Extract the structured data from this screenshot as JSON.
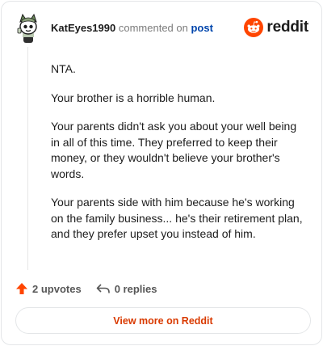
{
  "header": {
    "username": "KatEyes1990",
    "action_text": "commented on",
    "target_link": "post",
    "brand": "reddit"
  },
  "comment": {
    "paragraphs": [
      "NTA.",
      "Your brother is a horrible human.",
      "Your parents didn't ask you about your well being in all of this time. They preferred to keep their money, or they wouldn't believe your brother's words.",
      "Your parents side with him because he's working on the family business... he's their retirement plan, and they prefer upset you instead of him."
    ]
  },
  "footer": {
    "upvotes": "2 upvotes",
    "replies": "0 replies",
    "view_more": "View more on Reddit"
  },
  "colors": {
    "brand_orange": "#ff4500",
    "link_blue": "#0045ac",
    "cta_orange": "#d93a00"
  }
}
